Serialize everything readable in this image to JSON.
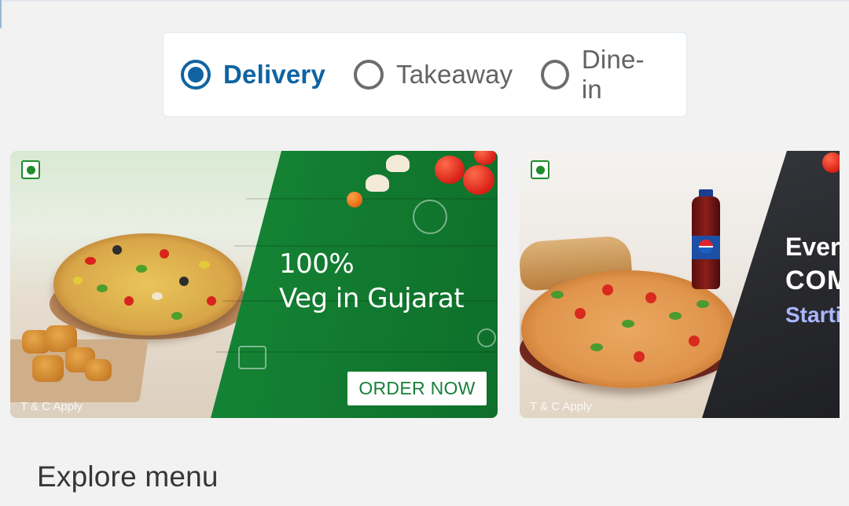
{
  "order_type": {
    "options": [
      {
        "label": "Delivery",
        "selected": true
      },
      {
        "label": "Takeaway",
        "selected": false
      },
      {
        "label": "Dine-in",
        "selected": false
      }
    ]
  },
  "banners": [
    {
      "headline_line1": "100%",
      "headline_line2": "Veg in Gujarat",
      "cta_label": "ORDER NOW",
      "terms": "T & C Apply"
    },
    {
      "headline_line1": "Every",
      "headline_line2": "COM",
      "headline_line3": "Starti",
      "terms": "T & C Apply"
    }
  ],
  "section": {
    "title": "Explore menu"
  },
  "colors": {
    "accent": "#0f63a3",
    "veg_green": "#1f8c2d",
    "banner_green": "#158535"
  }
}
